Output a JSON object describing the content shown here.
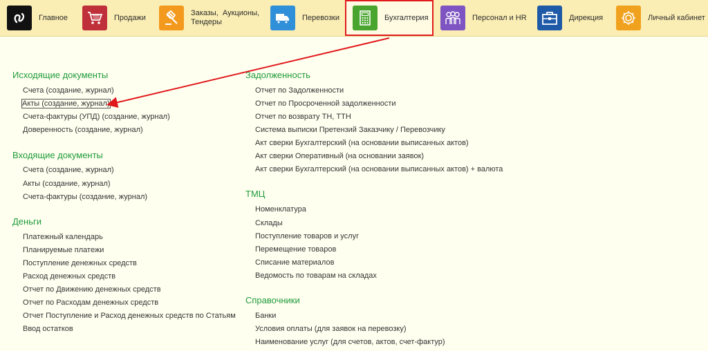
{
  "nav": {
    "tabs": [
      {
        "label": "Главное",
        "icon": "logo-icon",
        "color": "#111111"
      },
      {
        "label": "Продажи",
        "icon": "cart-icon",
        "color": "#c0303a"
      },
      {
        "label": "Заказы,  Аукционы,\nТендеры",
        "icon": "gavel-icon",
        "color": "#f39a1e"
      },
      {
        "label": "Перевозки",
        "icon": "truck-icon",
        "color": "#2f8fd8"
      },
      {
        "label": "Бухгалтерия",
        "icon": "calculator-icon",
        "color": "#4aa52e"
      },
      {
        "label": "Персонал и HR",
        "icon": "people-icon",
        "color": "#7e54c2"
      },
      {
        "label": "Дирекция",
        "icon": "briefcase-icon",
        "color": "#1f5aa8"
      },
      {
        "label": "Личный кабинет",
        "icon": "gear-icon",
        "color": "#f0a21e"
      }
    ],
    "active_index": 4
  },
  "left_sections": [
    {
      "title": "Исходящие документы",
      "items": [
        "Счета (создание, журнал)",
        "Акты (создание, журнал)",
        "Счета-фактуры (УПД) (создание, журнал)",
        "Доверенность (создание, журнал)"
      ]
    },
    {
      "title": "Входящие документы",
      "items": [
        "Счета (создание, журнал)",
        "Акты (создание, журнал)",
        "Счета-фактуры (создание, журнал)"
      ]
    },
    {
      "title": "Деньги",
      "items": [
        "Платежный календарь",
        "Планируемые платежи",
        "Поступление денежных средств",
        "Расход денежных средств",
        "Отчет по Движению денежных средств",
        "Отчет по Расходам денежных средств",
        "Отчет Поступление и Расход денежных средств по Статьям",
        "Ввод остатков"
      ]
    }
  ],
  "right_sections": [
    {
      "title": "Задолженность",
      "items": [
        "Отчет по Задолженности",
        "Отчет по Просроченной задолженности",
        "Отчет по возврату ТН, ТТН",
        "Система выписки Претензий Заказчику / Перевозчику",
        "Акт сверки Бухгалтерский (на основании выписанных актов)",
        "Акт сверки Оперативный (на основании заявок)",
        "Акт сверки Бухгалтерский (на основании выписанных актов) + валюта"
      ]
    },
    {
      "title": "ТМЦ",
      "items": [
        "Номенклатура",
        "Склады",
        "Поступление товаров и услуг",
        "Перемещение товаров",
        "Списание материалов",
        "Ведомость по товарам на складах"
      ]
    },
    {
      "title": "Справочники",
      "items": [
        "Банки",
        "Условия оплаты (для заявок на перевозку)",
        "Наименование услуг (для счетов, актов, счет-фактур)"
      ]
    }
  ],
  "highlight": {
    "annotation_color": "#e0191c",
    "text_color": "#1f9b3a"
  }
}
